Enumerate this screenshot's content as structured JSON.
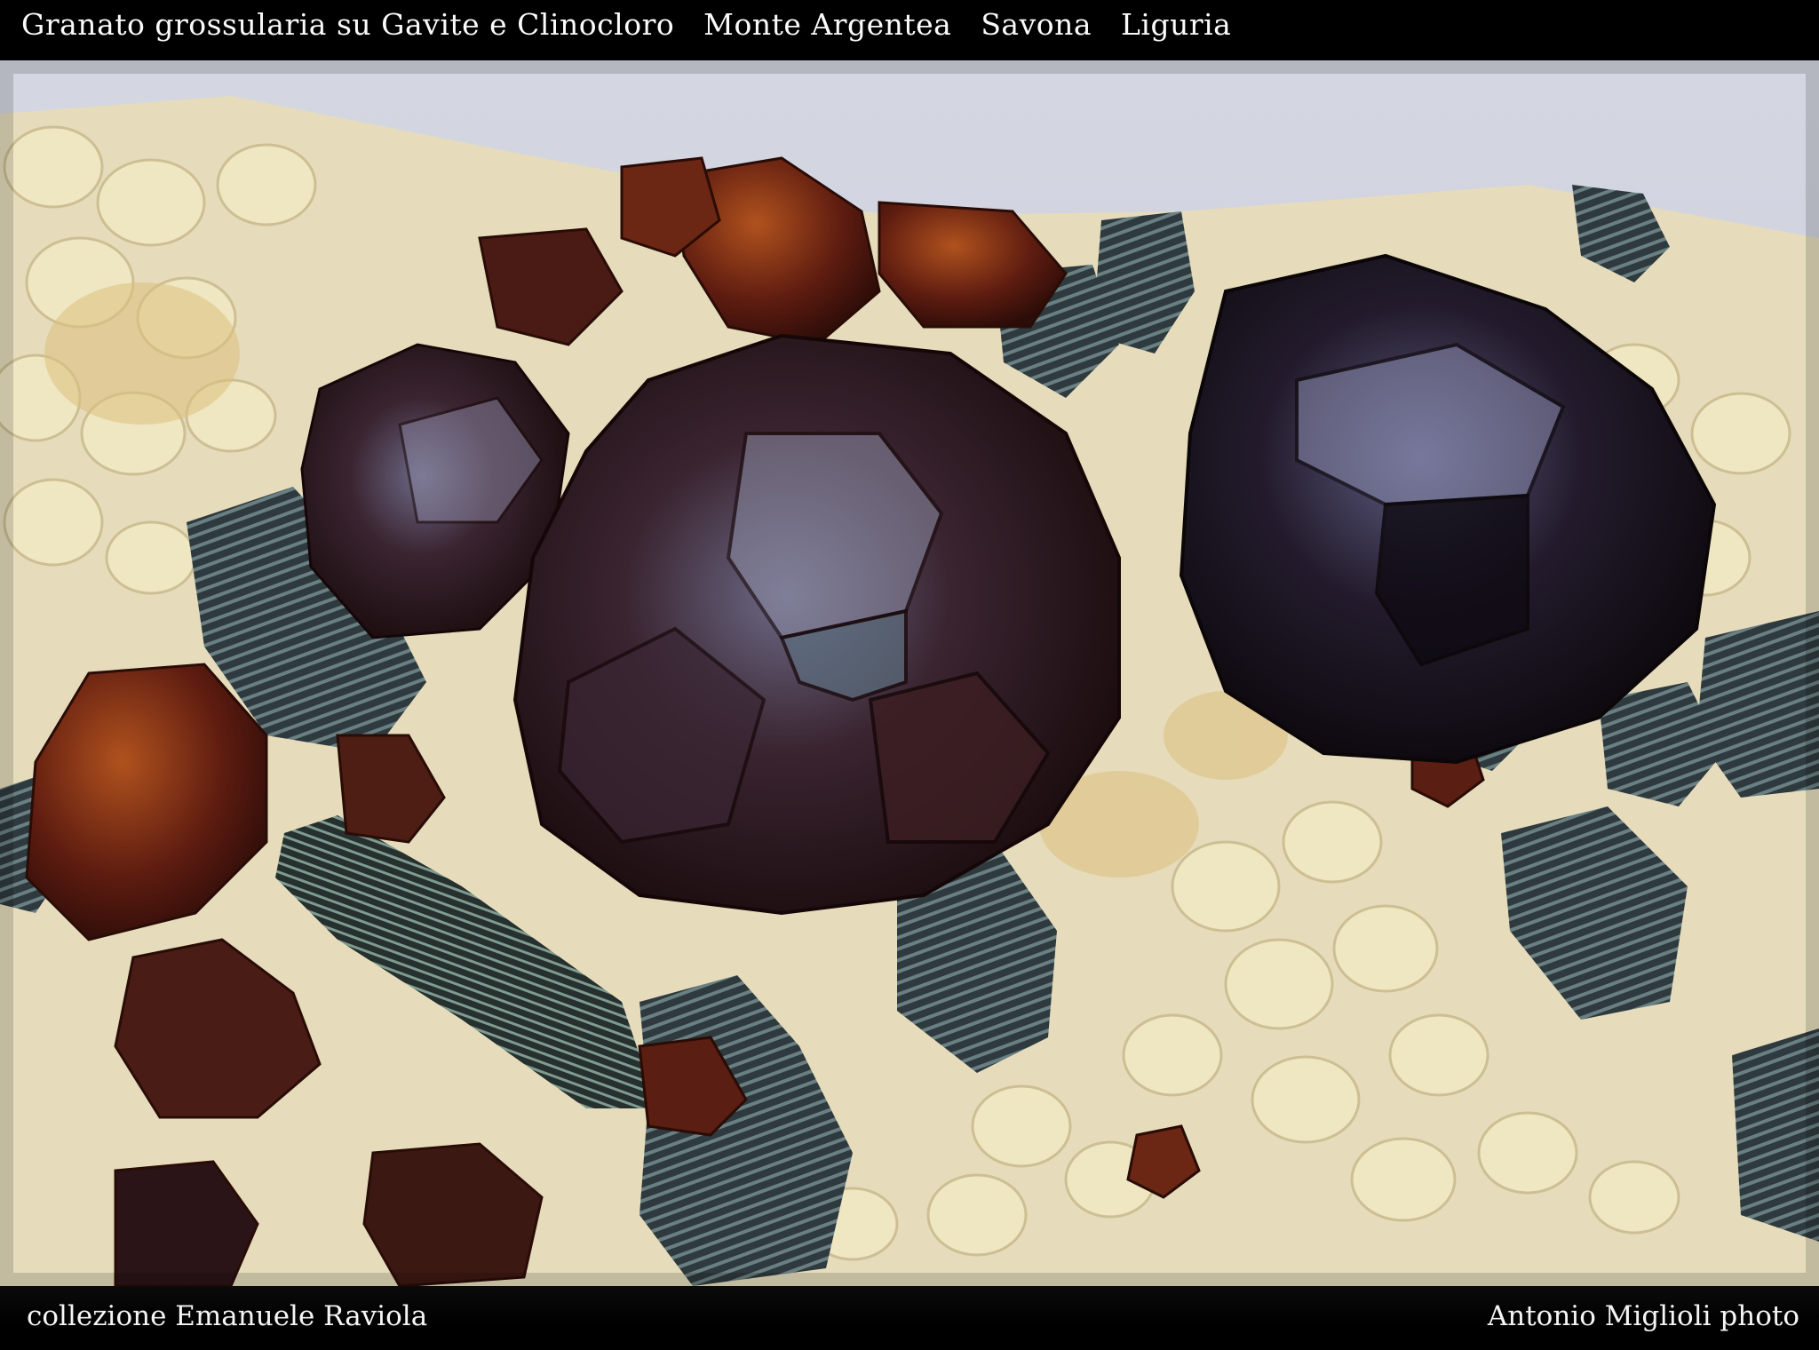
{
  "header": {
    "title": "Granato grossularia su Gavite e Clinocloro   Monte Argentea   Savona   Liguria"
  },
  "footer": {
    "collection": "collezione Emanuele Raviola",
    "credit": "Antonio Miglioli photo"
  },
  "image": {
    "subject": "grossular-garnet-crystals-on-matrix",
    "colors": {
      "background_sky": "#cfd3df",
      "matrix": "#e7dcb8",
      "garnet_dark": "#2a1210",
      "garnet_red": "#7a2a14",
      "chlorite": "#3b4a4c"
    }
  }
}
